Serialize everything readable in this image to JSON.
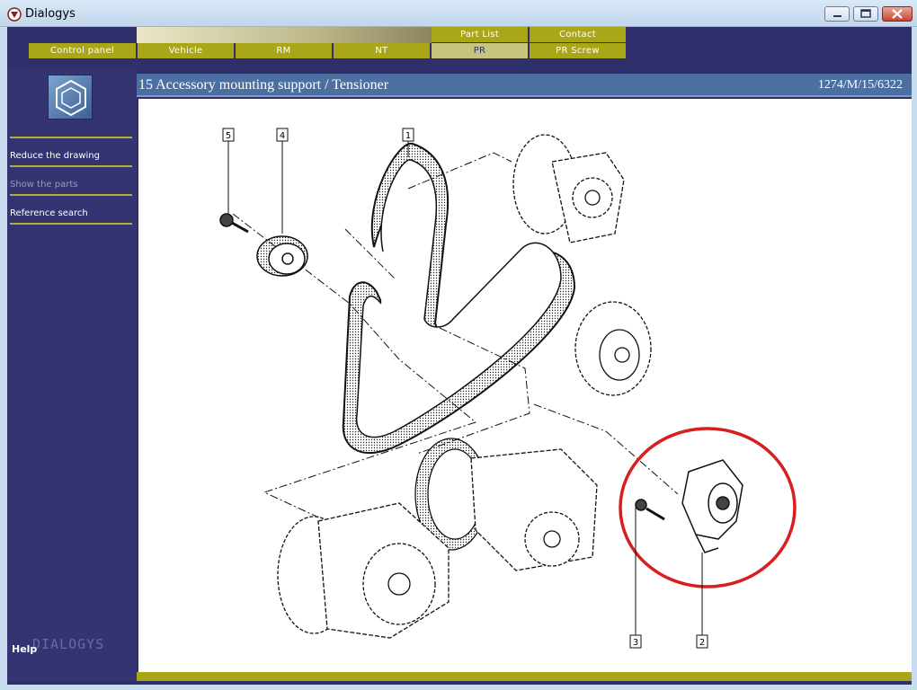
{
  "window": {
    "title": "Dialogys"
  },
  "nav": {
    "top_tabs": [
      {
        "label": "Part List"
      },
      {
        "label": "Contact"
      }
    ],
    "main_tabs": [
      {
        "label": "Control panel"
      },
      {
        "label": "Vehicle"
      },
      {
        "label": "RM"
      },
      {
        "label": "NT"
      },
      {
        "label": "PR",
        "active": true
      },
      {
        "label": "PR Screw"
      }
    ]
  },
  "sidebar": {
    "links": [
      {
        "label": "Reduce the drawing",
        "enabled": true
      },
      {
        "label": "Show the parts",
        "enabled": false
      },
      {
        "label": "Reference search",
        "enabled": true
      }
    ],
    "help_label": "Help",
    "watermark": "DIALOGYS"
  },
  "header": {
    "title": "15 Accessory mounting support / Tensioner",
    "reference": "1274/M/15/6322"
  },
  "drawing": {
    "callouts": [
      {
        "number": "1"
      },
      {
        "number": "2"
      },
      {
        "number": "3"
      },
      {
        "number": "4"
      },
      {
        "number": "5"
      }
    ],
    "highlight_color": "#d81f1f"
  },
  "colors": {
    "background": "#2f2f6b",
    "accent": "#a9a618",
    "header": "#4a6fa0"
  }
}
